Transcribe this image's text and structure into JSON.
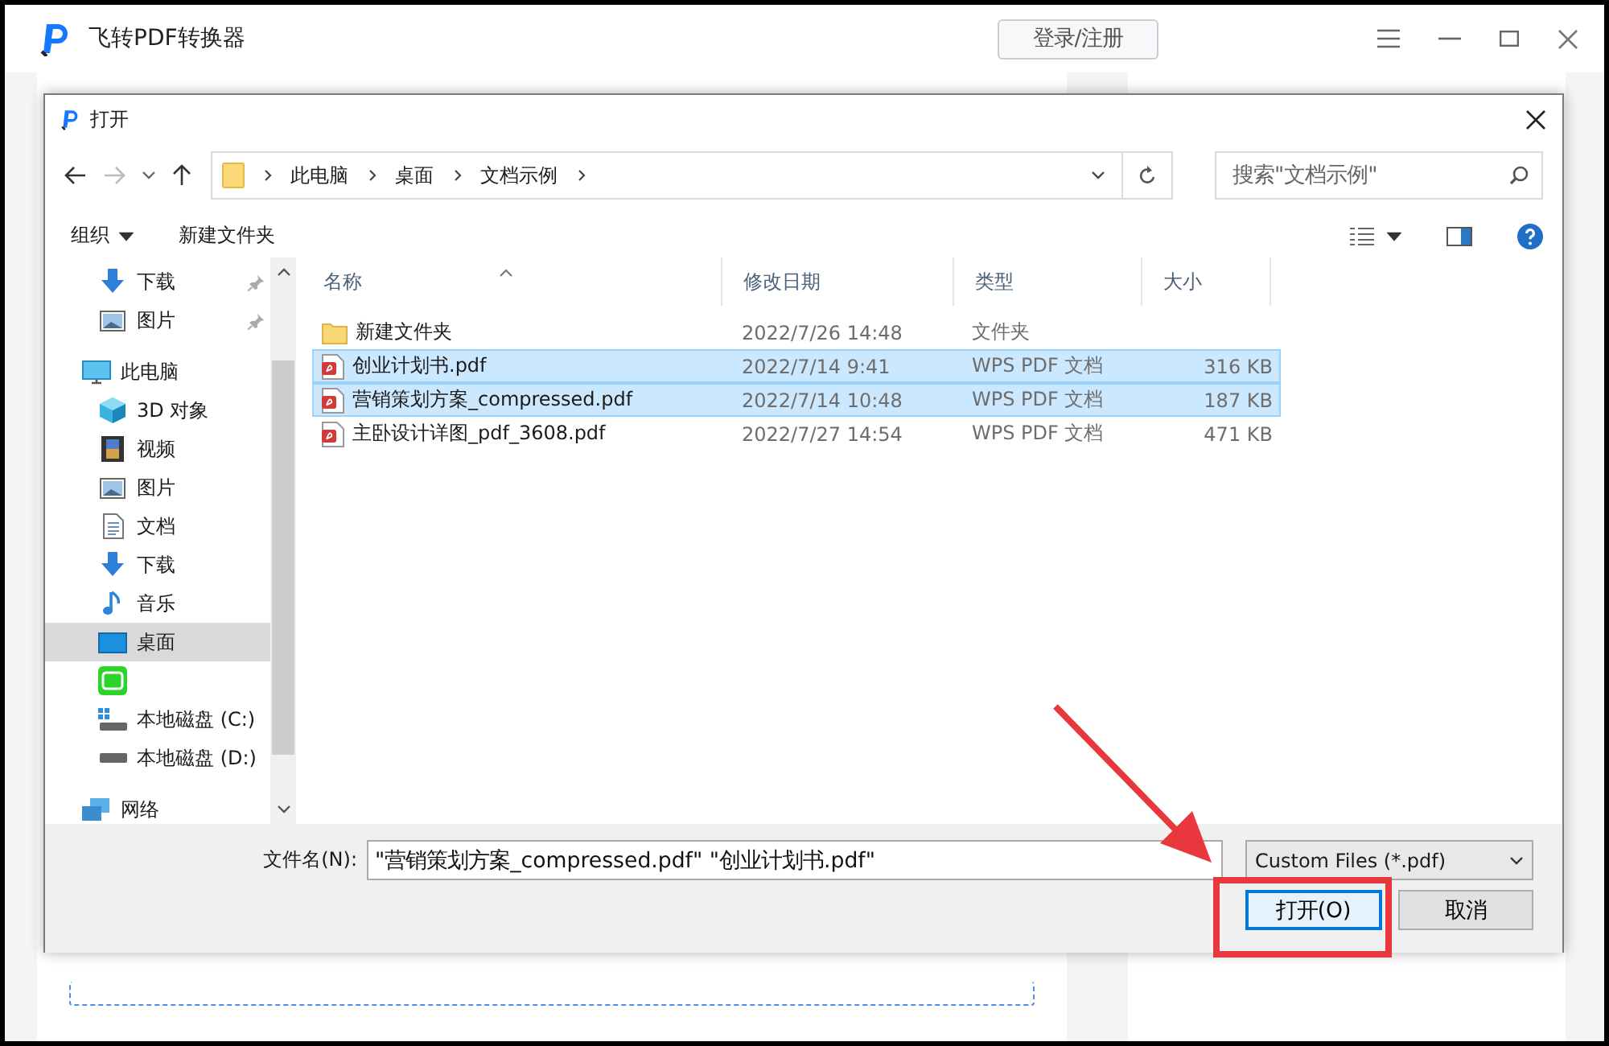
{
  "app": {
    "title": "飞转PDF转换器",
    "login_button": "登录/注册"
  },
  "dialog": {
    "title": "打开",
    "breadcrumb": [
      "此电脑",
      "桌面",
      "文档示例"
    ],
    "search": {
      "placeholder": "搜索\"文档示例\""
    },
    "toolbar": {
      "organize": "组织",
      "new_folder": "新建文件夹"
    },
    "sidebar": {
      "quick_access": [
        {
          "label": "下载",
          "kind": "download",
          "pinned": true,
          "selected": false
        },
        {
          "label": "图片",
          "kind": "pictures",
          "pinned": true,
          "selected": false
        }
      ],
      "items": [
        {
          "label": "此电脑",
          "kind": "pc",
          "selected": false,
          "children": [
            {
              "label": "3D 对象",
              "kind": "cube",
              "selected": false
            },
            {
              "label": "视频",
              "kind": "video",
              "selected": false
            },
            {
              "label": "图片",
              "kind": "pictures",
              "selected": false
            },
            {
              "label": "文档",
              "kind": "document",
              "selected": false
            },
            {
              "label": "下载",
              "kind": "download",
              "selected": false
            },
            {
              "label": "音乐",
              "kind": "music",
              "selected": false
            },
            {
              "label": "桌面",
              "kind": "desktop",
              "selected": true
            },
            {
              "kind": "app",
              "selected": false
            },
            {
              "label": "本地磁盘 (C:)",
              "kind": "system-drive",
              "selected": false
            },
            {
              "label": "本地磁盘 (D:)",
              "kind": "drive",
              "selected": false
            }
          ]
        },
        {
          "label": "网络",
          "kind": "network",
          "selected": false
        }
      ]
    },
    "files": {
      "columns": [
        "名称",
        "修改日期",
        "类型",
        "大小"
      ],
      "rows": [
        {
          "name": "新建文件夹",
          "date": "2022/7/26 14:48",
          "type": "文件夹",
          "kind": "folder",
          "selected": false
        },
        {
          "name": "创业计划书.pdf",
          "date": "2022/7/14 9:41",
          "type": "WPS PDF 文档",
          "size": "316 KB",
          "kind": "pdf",
          "selected": true
        },
        {
          "name": "营销策划方案_compressed.pdf",
          "date": "2022/7/14 10:48",
          "type": "WPS PDF 文档",
          "size": "187 KB",
          "kind": "pdf",
          "selected": true
        },
        {
          "name": "主卧设计详图_pdf_3608.pdf",
          "date": "2022/7/27 14:54",
          "type": "WPS PDF 文档",
          "size": "471 KB",
          "kind": "pdf",
          "selected": false
        }
      ]
    },
    "filename_label": "文件名(N):",
    "filename_value": "\"营销策划方案_compressed.pdf\" \"创业计划书.pdf\"",
    "filetype": "Custom Files (*.pdf)",
    "open_button": "打开(O)",
    "cancel_button": "取消"
  }
}
